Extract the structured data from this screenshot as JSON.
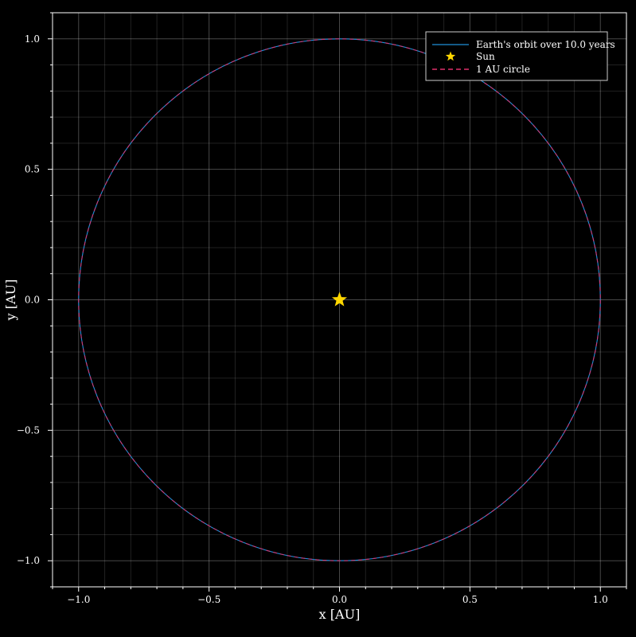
{
  "chart_data": {
    "type": "line",
    "title": "",
    "xlabel": "x [AU]",
    "ylabel": "y [AU]",
    "xlim": [
      -1.1,
      1.1
    ],
    "ylim": [
      -1.1,
      1.1
    ],
    "grid": true,
    "legend_position": "top-right",
    "x_ticks": [
      -1.0,
      -0.5,
      0.0,
      0.5,
      1.0
    ],
    "x_tick_labels": [
      "−1.0",
      "−0.5",
      "0.0",
      "0.5",
      "1.0"
    ],
    "y_ticks": [
      1.0,
      0.5,
      0.0,
      -0.5,
      -1.0
    ],
    "y_tick_labels": [
      "1.0",
      "0.5",
      "0.0",
      "−0.5",
      "−1.0"
    ],
    "series": [
      {
        "name": "Earth's orbit over 10.0 years",
        "kind": "line",
        "shape": "circle",
        "center": [
          0,
          0
        ],
        "radius": 1.0,
        "color": "#1f8fd8"
      },
      {
        "name": "Sun",
        "kind": "marker",
        "marker": "star",
        "x": [
          0.0
        ],
        "y": [
          0.0
        ],
        "color": "#ffd700"
      },
      {
        "name": "1 AU circle",
        "kind": "dashed-line",
        "shape": "circle",
        "center": [
          0,
          0
        ],
        "radius": 1.0,
        "color": "#e0306a"
      }
    ]
  },
  "legend": {
    "items": [
      "Earth's orbit over 10.0 years",
      "Sun",
      "1 AU circle"
    ]
  }
}
